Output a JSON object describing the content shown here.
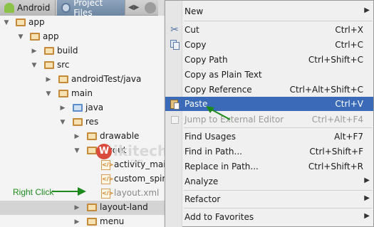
{
  "tabs": {
    "android": "Android",
    "project_files": "Project Files"
  },
  "tree": [
    {
      "label": "app",
      "icon": "folder"
    },
    {
      "label": "app",
      "icon": "folder"
    },
    {
      "label": "build",
      "icon": "folder"
    },
    {
      "label": "src",
      "icon": "folder"
    },
    {
      "label": "androidTest/java",
      "icon": "folder"
    },
    {
      "label": "main",
      "icon": "folder"
    },
    {
      "label": "java",
      "icon": "folder-blue"
    },
    {
      "label": "res",
      "icon": "folder"
    },
    {
      "label": "drawable",
      "icon": "folder"
    },
    {
      "label": "layout",
      "icon": "folder"
    },
    {
      "label": "activity_main.",
      "icon": "layout-file"
    },
    {
      "label": "custom_spinn",
      "icon": "layout-file"
    },
    {
      "label": "layout.xml",
      "icon": "layout-file"
    },
    {
      "label": "layout-land",
      "icon": "folder"
    },
    {
      "label": "menu",
      "icon": "folder"
    }
  ],
  "watermark": {
    "badge": "W",
    "text": "ikitechy",
    "sub": ".com"
  },
  "annotation": {
    "right_click": "Right Click"
  },
  "menu": {
    "new": "New",
    "cut": "Cut",
    "cut_short": "Ctrl+X",
    "copy": "Copy",
    "copy_short": "Ctrl+C",
    "copy_path": "Copy Path",
    "copy_path_short": "Ctrl+Shift+C",
    "copy_plain": "Copy as Plain Text",
    "copy_ref": "Copy Reference",
    "copy_ref_short": "Ctrl+Alt+Shift+C",
    "paste": "Paste",
    "paste_short": "Ctrl+V",
    "jump": "Jump to External Editor",
    "jump_short": "Ctrl+Alt+F4",
    "find_usages": "Find Usages",
    "find_usages_short": "Alt+F7",
    "find_in_path": "Find in Path...",
    "find_in_path_short": "Ctrl+Shift+F",
    "replace_in_path": "Replace in Path...",
    "replace_in_path_short": "Ctrl+Shift+R",
    "analyze": "Analyze",
    "refactor": "Refactor",
    "add_favorites": "Add to Favorites"
  },
  "colors": {
    "highlight": "#3b6bb8",
    "arrow": "#1e8a1e",
    "folder": "#c48a3a"
  }
}
